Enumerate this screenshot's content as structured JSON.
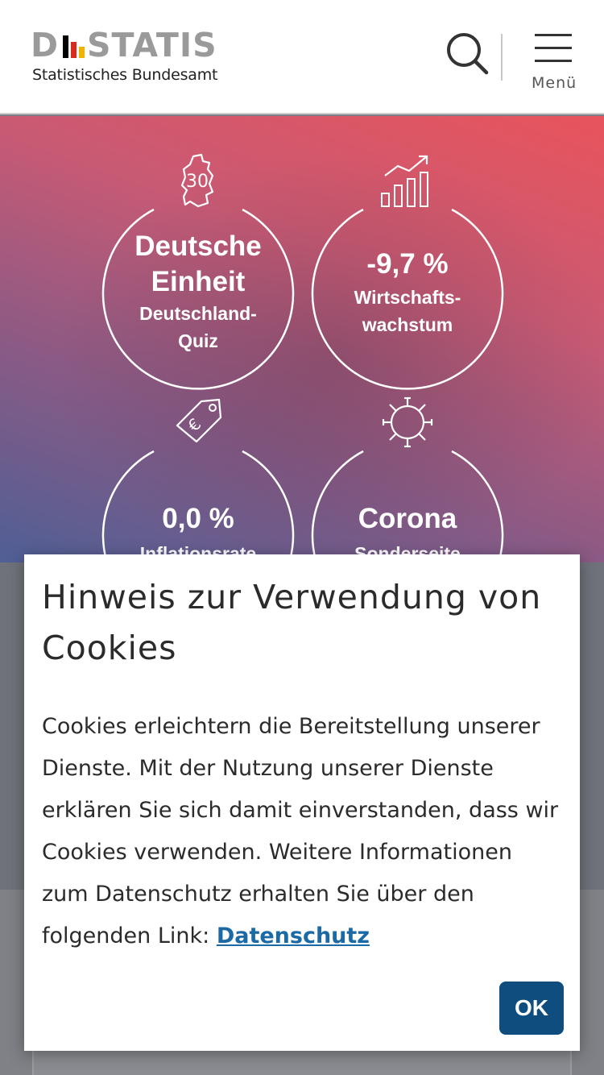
{
  "header": {
    "logo_word_left": "D",
    "logo_word_right": "STATIS",
    "logo_subtitle": "Statistisches Bundesamt",
    "search_icon": "search-icon",
    "menu_icon": "hamburger-icon",
    "menu_label": "Menü"
  },
  "hero": {
    "tiles": [
      {
        "icon": "germany-map-30-icon",
        "icon_text": "30",
        "headline": "Deutsche Einheit",
        "headline_line1": "Deutsche",
        "headline_line2": "Einheit",
        "sub_line1": "Deutschland-",
        "sub_line2": "Quiz"
      },
      {
        "icon": "growth-chart-icon",
        "headline": "-9,7 %",
        "sub_line1": "Wirtschafts-",
        "sub_line2": "wachstum"
      },
      {
        "icon": "euro-price-tag-icon",
        "headline": "0,0 %",
        "sub_line1": "Inflationsrate"
      },
      {
        "icon": "coronavirus-icon",
        "headline": "Corona",
        "sub_line1": "Sonderseite"
      }
    ]
  },
  "cookie_dialog": {
    "title": "Hinweis zur Verwendung von Cookies",
    "text": "Cookies erleichtern die Bereitstellung unserer Dienste. Mit der Nutzung unserer Dienste erklären Sie sich damit einverstanden, dass wir Cookies verwenden. Weitere Informationen zum Datenschutz erhalten Sie über den folgenden Link: ",
    "link_label": "Datenschutz",
    "ok_label": "OK"
  },
  "colors": {
    "hero_top": "#e8545c",
    "hero_bottom": "#4f5f95",
    "button_primary": "#0f4d7e",
    "link": "#1b6aa5"
  }
}
